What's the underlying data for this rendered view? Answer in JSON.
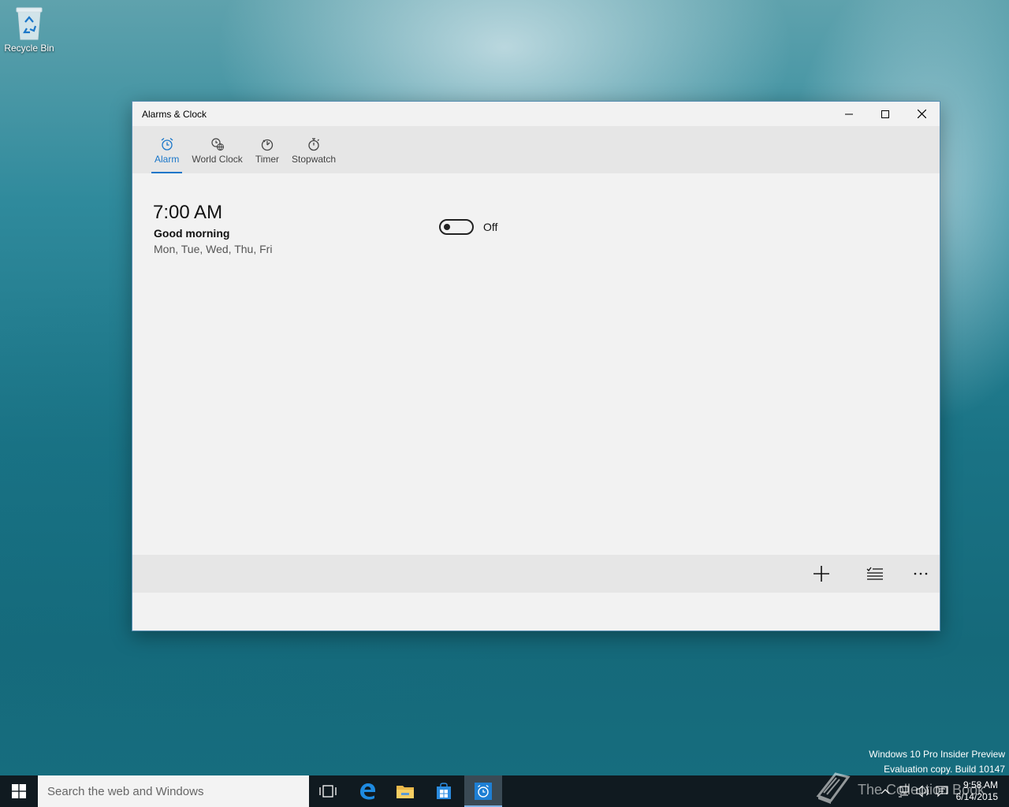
{
  "desktop": {
    "recycle_bin_label": "Recycle Bin"
  },
  "window": {
    "title": "Alarms & Clock",
    "accent_color": "#1976c9"
  },
  "tabs": [
    {
      "label": "Alarm",
      "icon": "alarm-clock-icon",
      "active": true
    },
    {
      "label": "World Clock",
      "icon": "world-clock-icon",
      "active": false
    },
    {
      "label": "Timer",
      "icon": "timer-icon",
      "active": false
    },
    {
      "label": "Stopwatch",
      "icon": "stopwatch-icon",
      "active": false
    }
  ],
  "alarm": {
    "time": "7:00 AM",
    "name": "Good morning",
    "days": "Mon, Tue, Wed, Thu, Fri",
    "toggle_state": "Off"
  },
  "commandbar": {
    "icons": [
      "add-icon",
      "select-list-icon",
      "more-icon"
    ]
  },
  "watermark": {
    "line1": "Windows 10 Pro Insider Preview",
    "line2": "Evaluation copy. Build 10147"
  },
  "taskbar": {
    "search_placeholder": "Search the web and Windows",
    "brand_text": "The Collection Book",
    "clock_time": "9:58 AM",
    "clock_date": "6/14/2015"
  }
}
